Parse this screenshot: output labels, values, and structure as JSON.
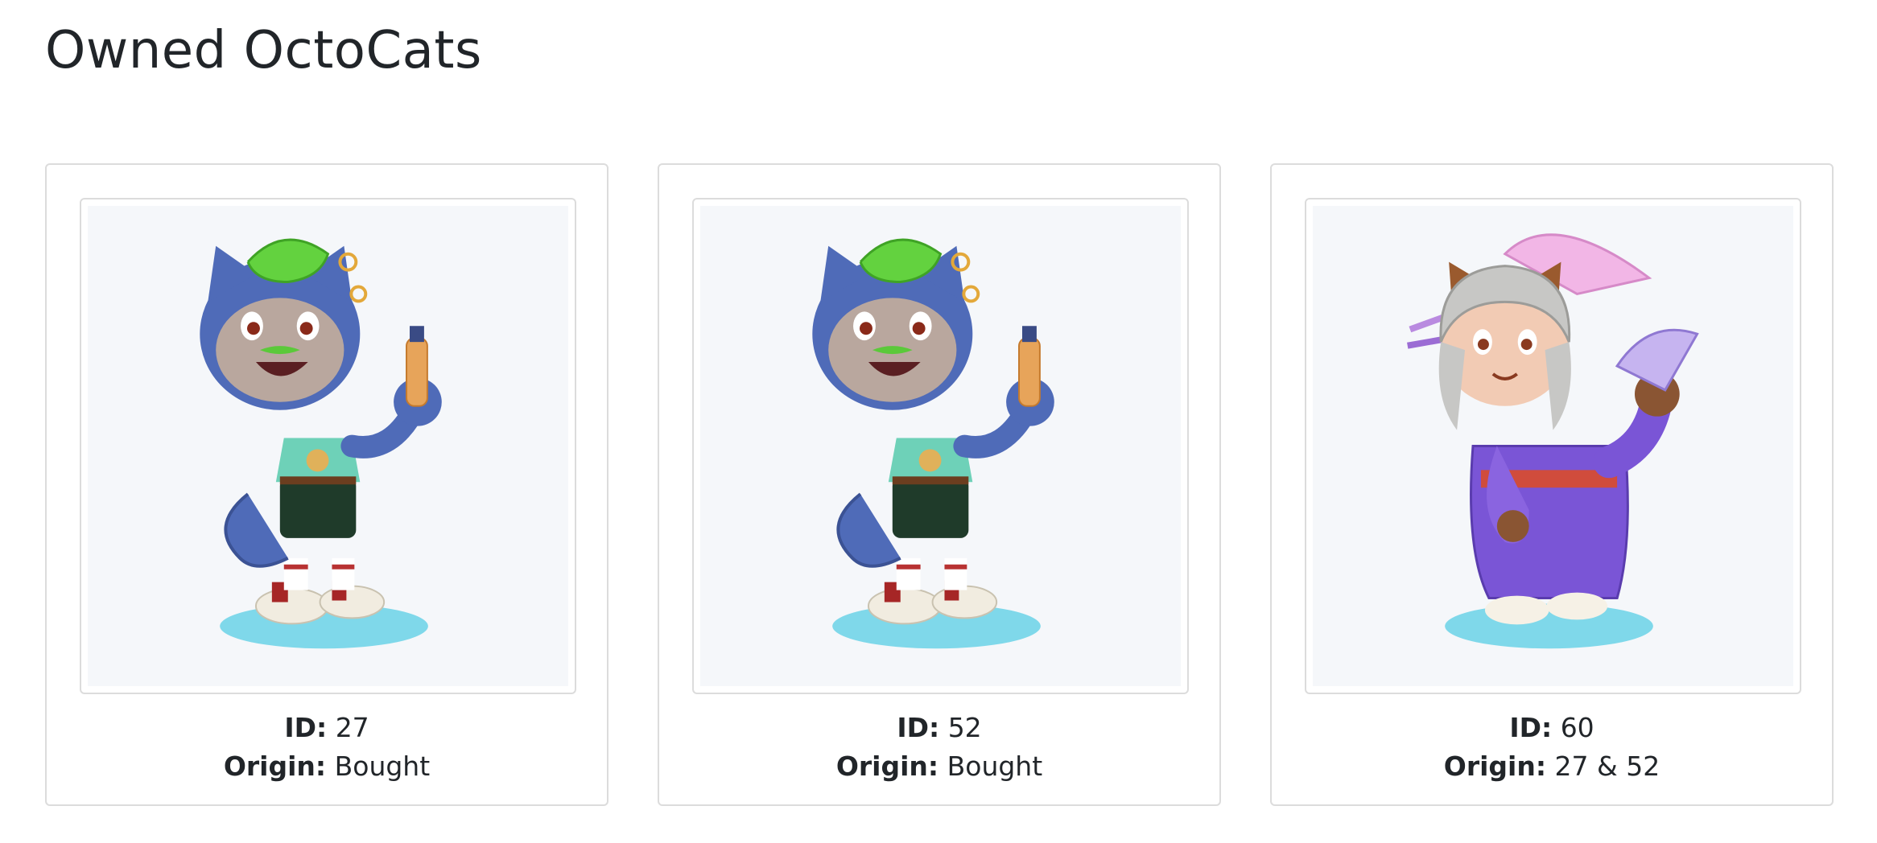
{
  "page": {
    "title": "Owned OctoCats"
  },
  "labels": {
    "id": "ID:",
    "origin": "Origin:"
  },
  "cats": [
    {
      "id": "27",
      "origin": "Bought",
      "image": "punk-octocat-green-mohawk-bottle"
    },
    {
      "id": "52",
      "origin": "Bought",
      "image": "punk-octocat-green-mohawk-bottle"
    },
    {
      "id": "60",
      "origin": "27 & 52",
      "image": "kimono-octocat-silver-hair-fan"
    }
  ],
  "colors": {
    "text": "#212529",
    "border": "#dcdcdc",
    "image_bg": "#f5f7fa"
  }
}
